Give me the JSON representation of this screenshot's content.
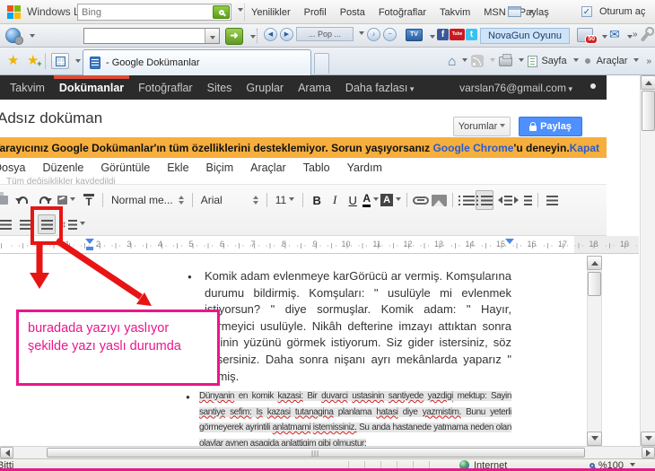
{
  "colors": {
    "accent_red": "#dd4b39",
    "share_blue": "#4d90fe",
    "warning_bg": "#f6ae3d",
    "link_blue": "#2a5dcc",
    "magenta": "#e9168c",
    "annotation_red": "#e81414"
  },
  "live_bar": {
    "brand": "Windows Live",
    "search_placeholder": "Bing",
    "links": [
      "Yenilikler",
      "Profil",
      "Posta",
      "Fotoğraflar",
      "Takvim",
      "MSN",
      "Paylaş"
    ],
    "signin": "Oturum aç"
  },
  "cmd_bar": {
    "media_label": "... Pop ...",
    "game_label": "NovaGun Oyunu",
    "badge_count": "50"
  },
  "tab_bar": {
    "active_tab_title": "- Google Dokümanlar",
    "page_label": "Sayfa",
    "tools_label": "Araçlar"
  },
  "google_bar": {
    "items": [
      {
        "label": "Takvim",
        "active": false,
        "arrow": false
      },
      {
        "label": "Dokümanlar",
        "active": true,
        "arrow": false
      },
      {
        "label": "Fotoğraflar",
        "active": false,
        "arrow": false
      },
      {
        "label": "Sites",
        "active": false,
        "arrow": false
      },
      {
        "label": "Gruplar",
        "active": false,
        "arrow": false
      },
      {
        "label": "Arama",
        "active": false,
        "arrow": false
      },
      {
        "label": "Daha fazlası",
        "active": false,
        "arrow": true
      }
    ],
    "account": "varslan76@gmail.com"
  },
  "header": {
    "title": "Adsız doküman",
    "comments": "Yorumlar",
    "share": "Paylaş"
  },
  "warning": {
    "text_before": "Tarayıcınız Google Dokümanlar'ın tüm özelliklerini desteklemiyor. Sorun yaşıyorsanız ",
    "chrome_link": "Google Chrome",
    "text_after": "'u deneyin.",
    "close": "Kapat"
  },
  "menus": [
    "Dosya",
    "Düzenle",
    "Görüntüle",
    "Ekle",
    "Biçim",
    "Araçlar",
    "Tablo",
    "Yardım"
  ],
  "toolbar": {
    "saved_note": "Tüm değişiklikler kaydedildi",
    "style_name": "Normal me...",
    "font_name": "Arial",
    "font_size": "11"
  },
  "ruler_numbers": [
    1,
    2,
    3,
    4,
    5,
    6,
    7,
    8,
    9,
    10,
    11,
    12,
    13,
    14,
    15,
    16,
    17,
    18,
    19
  ],
  "doc": {
    "bullet1": "Komik adam evlenmeye karGörücü ar vermiş. Komşularına durumu bildirmiş. Komşuları: \" usulüyle mi evlenmek istiyorsun? \" diye sormuşlar. Komik adam: \" Hayır, görmeyici usulüyle. Nikâh defterine imzayı attıktan sonra gelinin yüzünü görmek istiyorum. Siz gider istersiniz, söz kesersiniz. Daha sonra nişanı ayrı mekânlarda yaparız \" demiş.",
    "bullet2": "Dünyanin en komik kazasi: Bir duvarci ustasinin santiyede yazdigi mektup: Sayin santiye sefim: Is kazasi tutanagina planlama hatasi diye yazmistim. Bunu yeterli görmeyerek ayrintili anlatmami istemissiniz. Su anda hastanede yatmama neden olan olaylar aynen asagida anlattigim gibi olmustur:",
    "bullet2_misspelled": [
      "Dünyanin",
      "kazasi",
      "duvarci",
      "ustasinin",
      "santiyede",
      "yazdigi",
      "santiye",
      "sefim",
      "Is",
      "tutanagina",
      "hatasi",
      "yazmistim",
      "anlatmami",
      "istemissiniz",
      "asagida",
      "anlattigim",
      "olmustur"
    ]
  },
  "annotation": {
    "line1": "buradada yazıyı yaslıyor",
    "line2": "şekilde yazı yaslı durumda"
  },
  "status": {
    "done": "Bitti",
    "zone": "Internet",
    "zoom_level": "%100"
  }
}
